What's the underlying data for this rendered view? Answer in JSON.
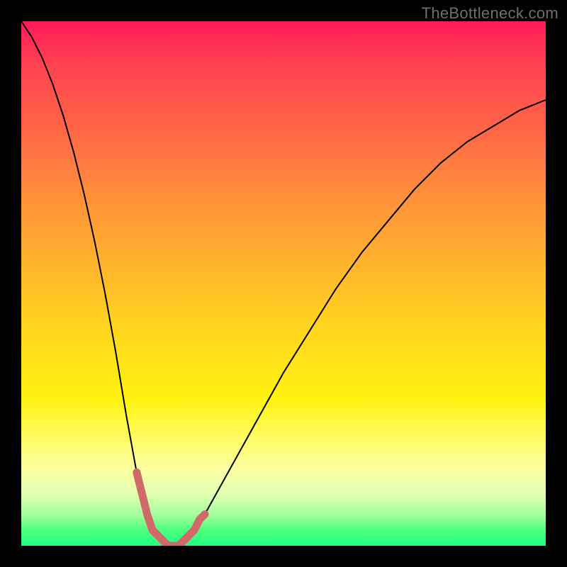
{
  "watermark": "TheBottleneck.com",
  "chart_data": {
    "type": "line",
    "title": "",
    "xlabel": "",
    "ylabel": "",
    "xlim": [
      0,
      100
    ],
    "ylim": [
      0,
      100
    ],
    "background_gradient": {
      "direction": "top-to-bottom",
      "stops": [
        {
          "pos": 0,
          "color": "#ff1a58"
        },
        {
          "pos": 22,
          "color": "#ff6a45"
        },
        {
          "pos": 45,
          "color": "#ffb02e"
        },
        {
          "pos": 72,
          "color": "#fff210"
        },
        {
          "pos": 90,
          "color": "#e2ffb0"
        },
        {
          "pos": 100,
          "color": "#1fff80"
        }
      ]
    },
    "series": [
      {
        "name": "bottleneck-curve",
        "color": "#000000",
        "stroke_width": 2,
        "x": [
          0,
          2,
          4,
          6,
          8,
          10,
          12,
          14,
          16,
          18,
          20,
          22,
          24,
          26,
          28,
          30,
          32,
          35,
          40,
          45,
          50,
          55,
          60,
          65,
          70,
          75,
          80,
          85,
          90,
          95,
          100
        ],
        "y": [
          100,
          97,
          93,
          88,
          82,
          75,
          67,
          58,
          48,
          37,
          25,
          14,
          6,
          2,
          0,
          0,
          2,
          6,
          15,
          24,
          33,
          41,
          49,
          56,
          62,
          68,
          73,
          77,
          80,
          83,
          85
        ]
      },
      {
        "name": "bottom-highlight",
        "color": "#d06a6a",
        "stroke_width": 11,
        "linecap": "round",
        "x": [
          22,
          23,
          24,
          25,
          26,
          27,
          28,
          29,
          30,
          31,
          32,
          33,
          34,
          35
        ],
        "y": [
          14,
          10,
          6,
          3,
          2,
          1,
          0,
          0,
          0,
          1,
          2,
          3,
          5,
          6
        ]
      }
    ]
  }
}
